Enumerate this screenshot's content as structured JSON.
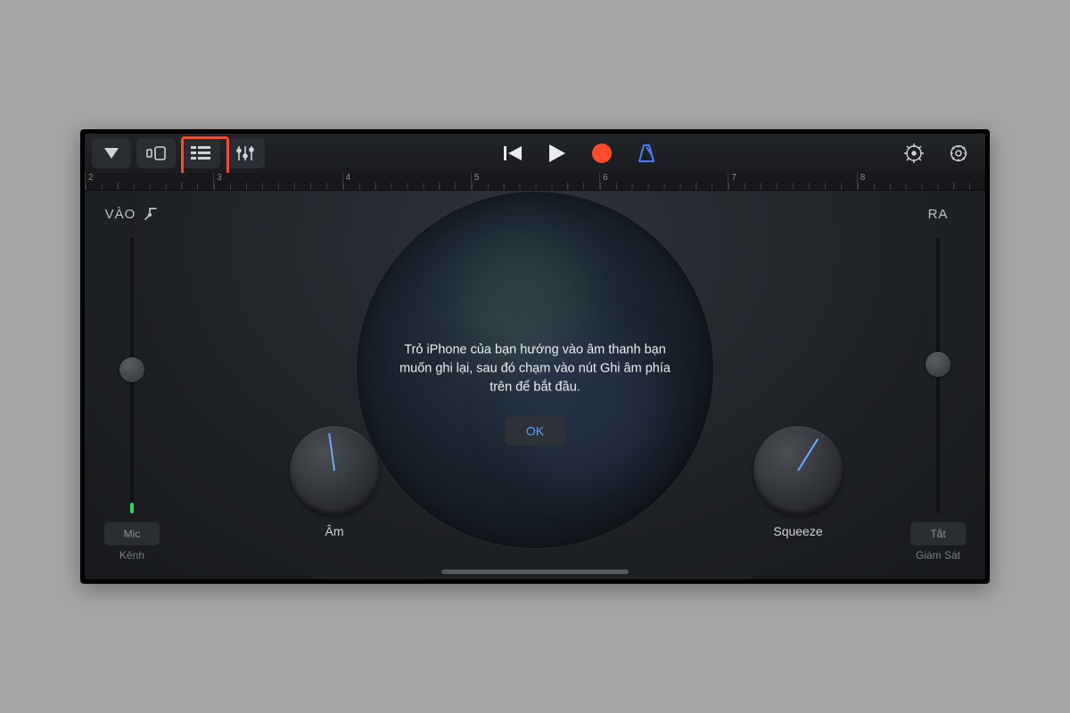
{
  "toolbar": {
    "ruler_marks": [
      "2",
      "3",
      "4",
      "5",
      "6",
      "7",
      "8"
    ]
  },
  "left": {
    "title": "VÀO",
    "chip": "Mic",
    "sublabel": "Kênh",
    "slider_pct": 48,
    "level_pct": 4
  },
  "right": {
    "title": "RA",
    "chip": "Tắt",
    "sublabel": "Giám Sát",
    "slider_pct": 46
  },
  "knobs": {
    "tone": {
      "label": "Âm",
      "angle_deg": -8
    },
    "squeeze": {
      "label": "Squeeze",
      "angle_deg": 32
    }
  },
  "popup": {
    "message": "Trỏ iPhone của bạn hướng vào âm thanh bạn muốn ghi lại, sau đó chạm vào nút Ghi âm phía trên để bắt đầu.",
    "ok": "OK"
  },
  "colors": {
    "record": "#ff4a2e",
    "metronome": "#4f7dff",
    "accent_highlight": "#ff4a2e"
  }
}
